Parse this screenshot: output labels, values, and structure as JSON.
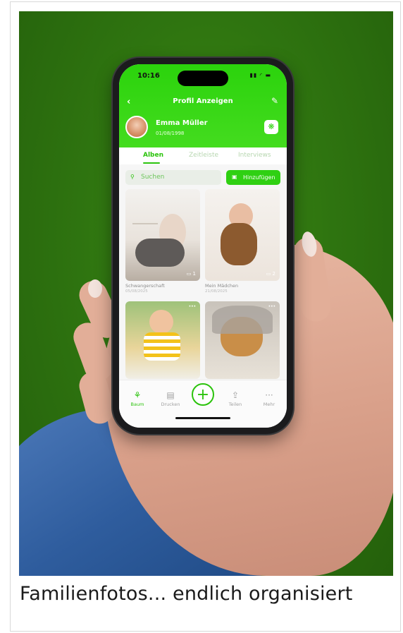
{
  "caption": "Familienfotos... endlich organisiert",
  "colors": {
    "accent": "#2bd30c",
    "background_photo": "#2f7510"
  },
  "phone": {
    "status": {
      "time": "10:16",
      "icons": "▮▮ ◜ ▬"
    },
    "nav": {
      "back_icon": "chevron-left-icon",
      "title": "Profil Anzeigen",
      "edit_icon": "edit-icon"
    },
    "profile": {
      "name": "Emma Müller",
      "date": "01/08/1998"
    },
    "tabs": [
      {
        "label": "Alben",
        "active": true
      },
      {
        "label": "Zeitleiste",
        "active": false
      },
      {
        "label": "Interviews",
        "active": false
      }
    ],
    "search": {
      "placeholder": "Suchen"
    },
    "add_button": {
      "label": "Hinzufügen"
    },
    "albums": [
      {
        "name": "Schwangerschaft",
        "date": "05/08/2025",
        "count": "▭ 1"
      },
      {
        "name": "Mein Mädchen",
        "date": "21/08/2025",
        "count": "▭ 2"
      },
      {
        "name": "",
        "date": "",
        "count": ""
      },
      {
        "name": "",
        "date": "",
        "count": ""
      }
    ],
    "bottom_nav": [
      {
        "label": "Baum",
        "icon": "tree-icon",
        "active": true
      },
      {
        "label": "Drucken",
        "icon": "print-icon",
        "active": false
      },
      {
        "label": "Teilen",
        "icon": "share-icon",
        "active": false
      },
      {
        "label": "Mehr",
        "icon": "more-icon",
        "active": false
      }
    ]
  }
}
